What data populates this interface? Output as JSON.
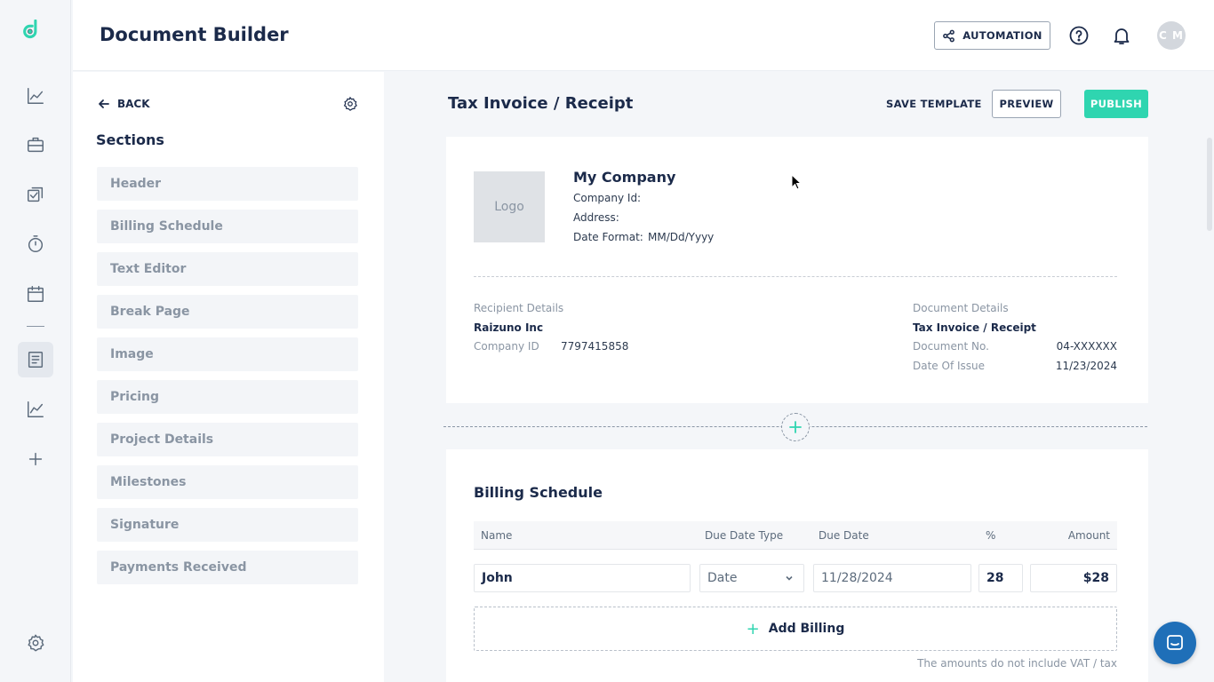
{
  "header": {
    "title": "Document Builder",
    "automation_label": "AUTOMATION",
    "avatar_initials": "C M"
  },
  "rail": {
    "icons": [
      "logo-icon",
      "analytics-icon",
      "briefcase-icon",
      "tasks-icon",
      "timer-icon",
      "calendar-icon",
      "document-icon",
      "reports-icon",
      "plus-icon",
      "settings-icon"
    ],
    "active": "document-icon"
  },
  "sections_panel": {
    "back_label": "BACK",
    "title": "Sections",
    "items": [
      "Header",
      "Billing Schedule",
      "Text Editor",
      "Break Page",
      "Image",
      "Pricing",
      "Project Details",
      "Milestones",
      "Signature",
      "Payments Received"
    ]
  },
  "editor": {
    "doc_title": "Tax Invoice / Receipt",
    "save_template_label": "SAVE TEMPLATE",
    "preview_label": "PREVIEW",
    "publish_label": "PUBLISH"
  },
  "company": {
    "logo_placeholder": "Logo",
    "name": "My Company",
    "company_id_label": "Company Id:",
    "address_label": "Address:",
    "date_format_label": "Date Format:",
    "date_format_value": "MM/Dd/Yyyy"
  },
  "recipient": {
    "heading": "Recipient Details",
    "name": "Raizuno Inc",
    "company_id_label": "Company ID",
    "company_id_value": "7797415858"
  },
  "document": {
    "heading": "Document Details",
    "name": "Tax Invoice / Receipt",
    "doc_no_label": "Document No.",
    "doc_no_value": "04-XXXXXX",
    "date_issue_label": "Date Of Issue",
    "date_issue_value": "11/23/2024"
  },
  "billing": {
    "title": "Billing Schedule",
    "columns": [
      "Name",
      "Due Date Type",
      "Due Date",
      "%",
      "Amount"
    ],
    "row": {
      "name": "John",
      "due_date_type": "Date",
      "due_date": "11/28/2024",
      "percent": "28",
      "amount": "$28"
    },
    "add_label": "Add Billing",
    "vat_note": "The amounts do not include VAT / tax"
  },
  "colors": {
    "accent": "#2fd5b0",
    "primary_text": "#1b2a4a",
    "chat": "#1f6fb8"
  }
}
